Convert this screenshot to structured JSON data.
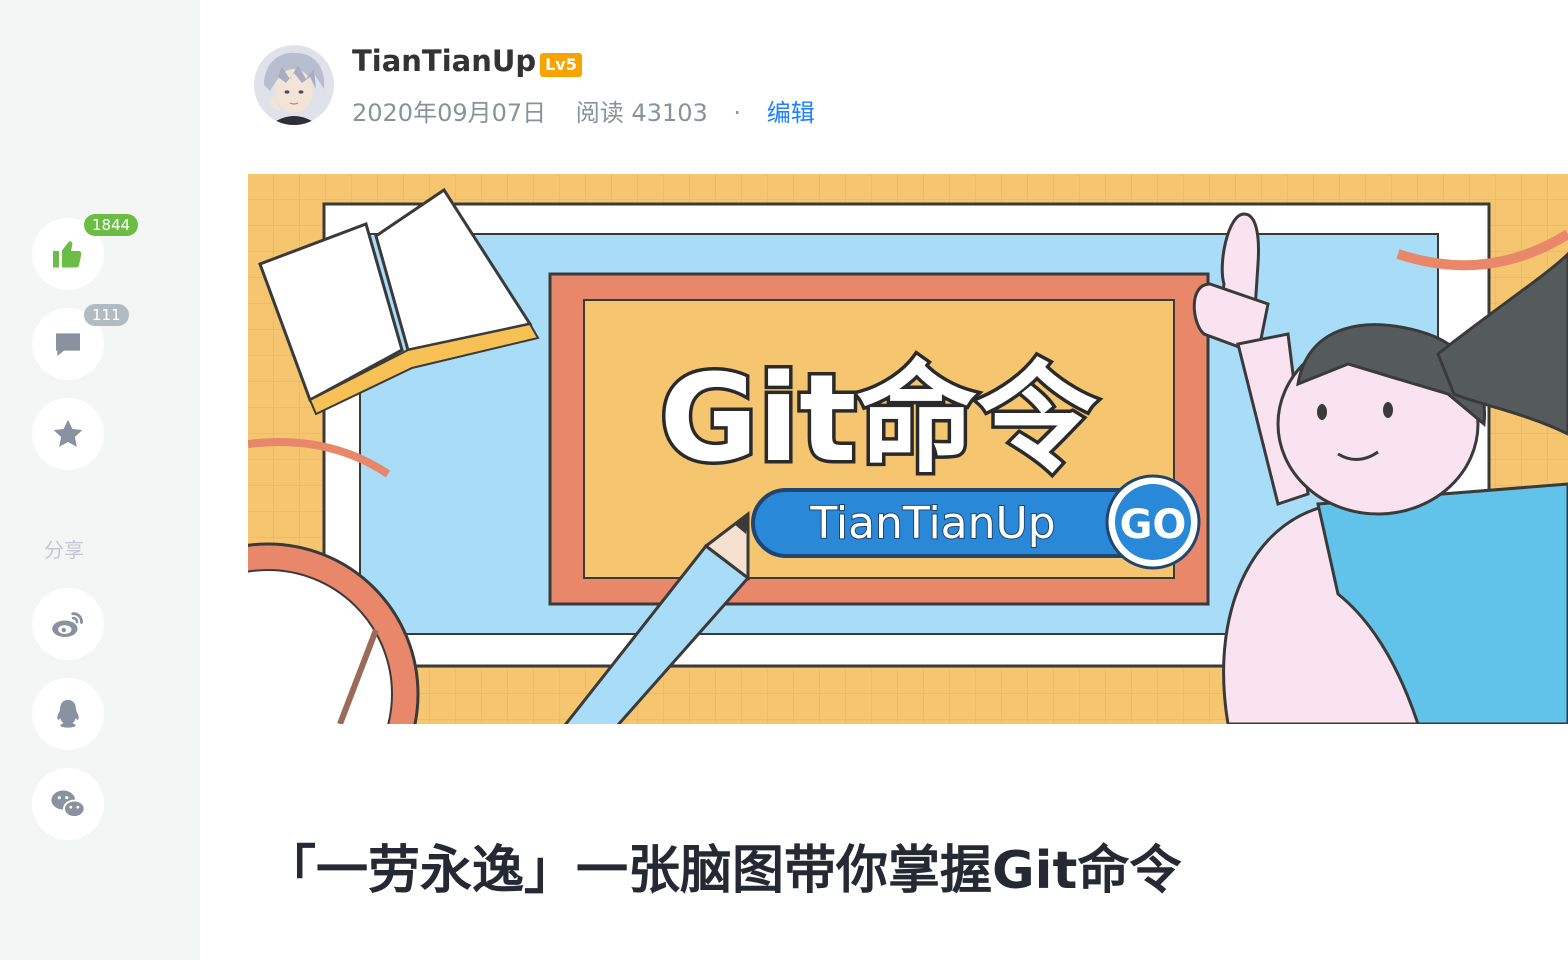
{
  "sidebar": {
    "like_count": "1844",
    "comment_count": "111",
    "share_label": "分享",
    "icons": {
      "like": "thumbs-up-icon",
      "comment": "comment-icon",
      "collect": "star-icon",
      "weibo": "weibo-icon",
      "qq": "qq-icon",
      "wechat": "wechat-icon"
    },
    "colors": {
      "like_active": "#6cbd45",
      "icon_grey": "#8a919f"
    }
  },
  "author": {
    "name": "TianTianUp",
    "level": "Lv5",
    "date": "2020年09月07日",
    "reads": "阅读 43103",
    "separator": "·",
    "edit_label": "编辑"
  },
  "cover": {
    "main_text": "Git命令",
    "sub_text": "TianTianUp",
    "badge_text": "GO"
  },
  "article": {
    "title": "「一劳永逸」一张脑图带你掌握Git命令"
  },
  "colors": {
    "link": "#1e80ff",
    "level_badge": "#f7a400",
    "cover_bg": "#f5c56f",
    "cover_frame": "#e9876a"
  }
}
